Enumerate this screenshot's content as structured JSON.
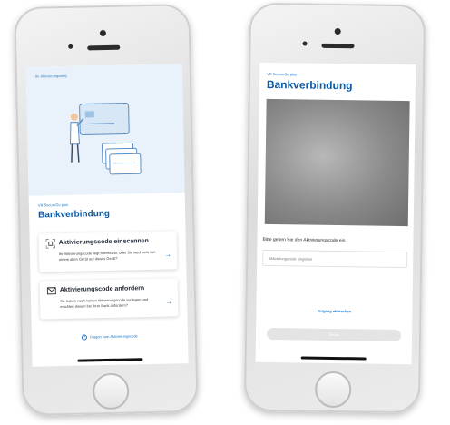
{
  "left_screen": {
    "hero_caption": "Ihr Aktivierungsweg",
    "brand": "VR SecureGo plus",
    "title": "Bankverbindung",
    "cards": [
      {
        "title": "Aktivierungscode einscannen",
        "description": "Ihr Aktivierungscode liegt bereits vor, oder Sie wechseln von einem alten Gerät auf dieses Gerät?",
        "icon": "qr-scan-icon"
      },
      {
        "title": "Aktivierungscode anfordern",
        "description": "Sie haben noch keinen Aktivierungscode vorliegen und möchten diesen bei Ihrer Bank anfordern?",
        "icon": "mail-icon"
      }
    ],
    "help_link": "Fragen zum Aktivierungscode"
  },
  "right_screen": {
    "brand": "VR SecureGo plus",
    "title": "Bankverbindung",
    "prompt": "Bitte geben Sie den Aktivierungscode ein.",
    "input_placeholder": "Aktivierungscode eingeben",
    "cancel_label": "Vorgang abbrechen",
    "next_label": "Weiter"
  },
  "colors": {
    "brand_blue": "#0b5aa8",
    "link_blue": "#1673c6",
    "hero_background": "#e9f2fa"
  }
}
